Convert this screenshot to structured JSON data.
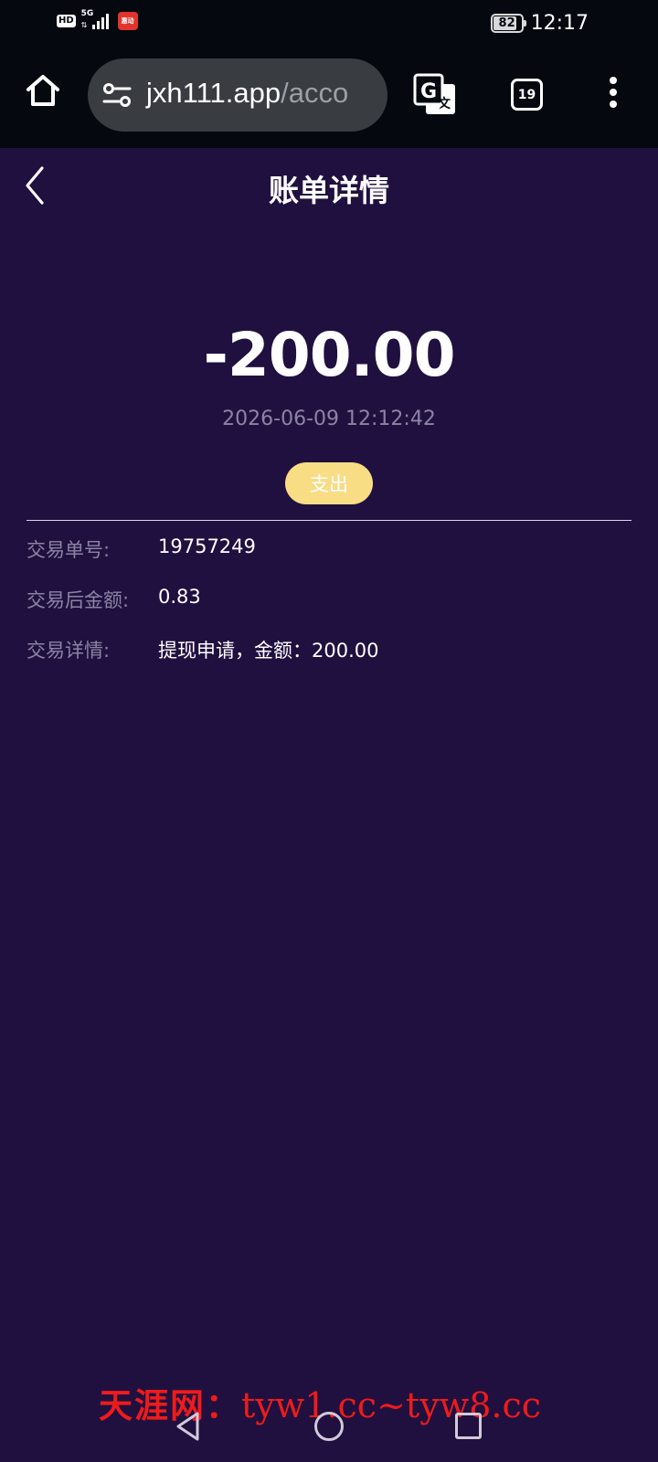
{
  "status_bar": {
    "hd_label": "HD",
    "network_label": "5G",
    "battery_level": "82",
    "time": "12:17",
    "app_badge_text": "惠动"
  },
  "browser": {
    "url_domain": "jxh111.app",
    "url_path": "/acco",
    "tab_count": "19",
    "icons": {
      "home": "home-icon",
      "site_settings": "tune-icon",
      "translate": "translate-icon",
      "menu": "more-vert-icon"
    }
  },
  "header": {
    "title": "账单详情",
    "back_icon": "chevron-left-icon"
  },
  "transaction": {
    "amount": "-200.00",
    "datetime": "2026-06-09 12:12:42",
    "type_label": "支出",
    "details": [
      {
        "label": "交易单号:",
        "value": "19757249"
      },
      {
        "label": "交易后金额:",
        "value": "0.83"
      },
      {
        "label": "交易详情:",
        "value": "提现申请，金额：200.00"
      }
    ]
  },
  "watermark": {
    "cn": "天涯网：",
    "en": "tyw1.cc~tyw8.cc"
  },
  "colors": {
    "background": "#201040",
    "toolbar": "#05080f",
    "badge": "#f8dd84",
    "muted_text": "#8b84a3",
    "watermark": "#ef1b1b"
  }
}
